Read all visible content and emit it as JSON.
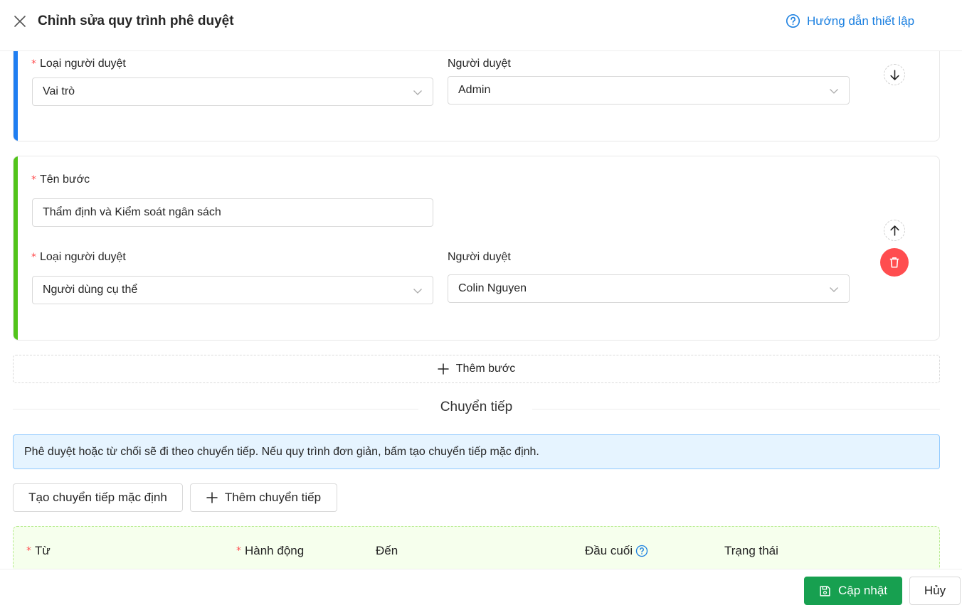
{
  "header": {
    "title": "Chỉnh sửa quy trình phê duyệt",
    "help_link": "Hướng dẫn thiết lập"
  },
  "steps": [
    {
      "approver_type_label": "Loại người duyệt",
      "approver_type_value": "Vai trò",
      "approver_label": "Người duyệt",
      "approver_value": "Admin",
      "accent_color": "#1f7ef2"
    },
    {
      "step_name_label": "Tên bước",
      "step_name_value": "Thẩm định và Kiểm soát ngân sách",
      "approver_type_label": "Loại người duyệt",
      "approver_type_value": "Người dùng cụ thể",
      "approver_label": "Người duyệt",
      "approver_value": "Colin Nguyen",
      "accent_color": "#52c41a"
    }
  ],
  "add_step_label": "Thêm bước",
  "transitions": {
    "section_title": "Chuyển tiếp",
    "info_text": "Phê duyệt hoặc từ chối sẽ đi theo chuyển tiếp. Nếu quy trình đơn giản, bấm tạo chuyển tiếp mặc định.",
    "create_default_label": "Tạo chuyển tiếp mặc định",
    "add_transition_label": "Thêm chuyển tiếp",
    "columns": {
      "from": "Từ",
      "action": "Hành động",
      "to": "Đến",
      "terminal": "Đầu cuối",
      "status": "Trạng thái"
    }
  },
  "footer": {
    "update_label": "Cập nhật",
    "cancel_label": "Hủy"
  },
  "icons": {
    "close": "close-icon",
    "help": "question-circle-icon",
    "chevron": "chevron-down-icon",
    "move_down": "arrow-down-icon",
    "move_up": "arrow-up-icon",
    "delete": "trash-icon",
    "plus": "plus-icon",
    "save": "save-icon"
  },
  "colors": {
    "primary": "#17a050",
    "link": "#1a7fe0",
    "danger": "#ff4d4f",
    "info_bg": "#e6f4ff"
  }
}
